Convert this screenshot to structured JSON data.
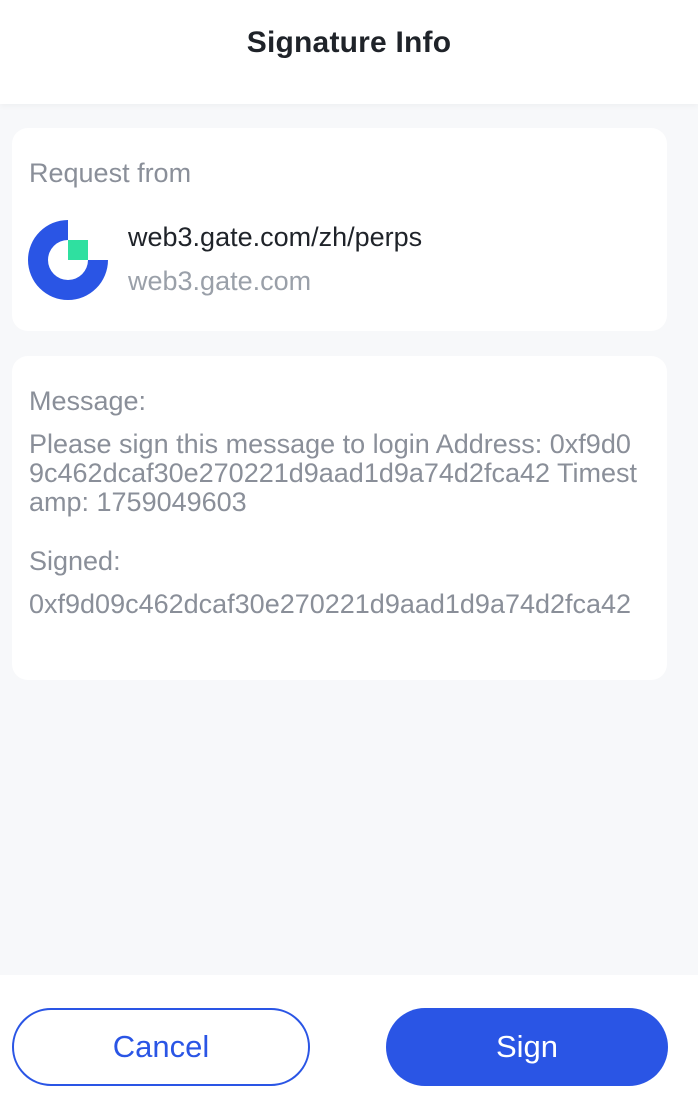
{
  "header": {
    "title": "Signature Info"
  },
  "request": {
    "label": "Request from",
    "site_title": "web3.gate.com/zh/perps",
    "site_domain": "web3.gate.com",
    "logo_icon": "gate-logo-icon"
  },
  "message": {
    "label": "Message:",
    "text": "Please sign this message to login Address: 0xf9d09c462dcaf30e270221d9aad1d9a74d2fca42 Timestamp: 1759049603",
    "signed_label": "Signed:",
    "signed_value": "0xf9d09c462dcaf30e270221d9aad1d9a74d2fca42"
  },
  "actions": {
    "cancel_label": "Cancel",
    "sign_label": "Sign"
  },
  "colors": {
    "accent": "#2a55e5",
    "logo_green": "#2fe0a0",
    "background": "#f7f8fa"
  }
}
